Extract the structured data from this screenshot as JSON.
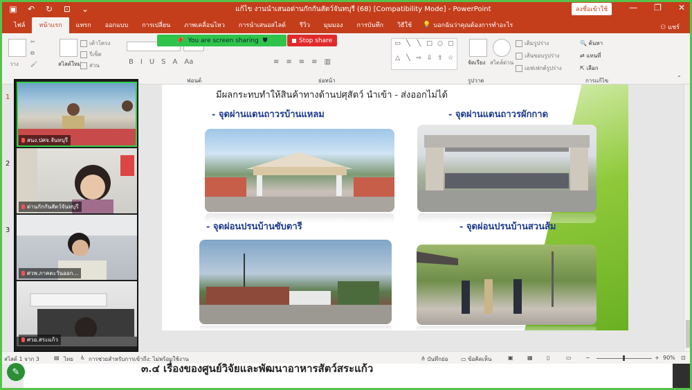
{
  "window": {
    "title": "แก้ไข งานนำเสนอด่านกักกันสัตว์จันทบุรี (68) [Compatibility Mode]  -  PowerPoint",
    "signin_label": "ลงชื่อเข้าใช้"
  },
  "tabs": [
    "ไฟล์",
    "หน้าแรก",
    "แทรก",
    "ออกแบบ",
    "การเปลี่ยน",
    "ภาพเคลื่อนไหว",
    "การนำเสนอสไลด์",
    "รีวิว",
    "มุมมอง",
    "การบันทึก",
    "วิธีใช้"
  ],
  "tell_me": "บอกฉันว่าคุณต้องการทำอะไร",
  "share_label": "แชร์",
  "screen_share": {
    "status": "You are screen sharing",
    "stop_label": "Stop share"
  },
  "ribbon": {
    "paste": "วาง",
    "new_slide": "สไลด์ใหม่",
    "layout": "เค้าโครง",
    "reset": "รีเซ็ต",
    "section": "ส่วน",
    "arrange": "จัดเรียง",
    "quick_styles": "สไตล์ด่วน",
    "shape_fill": "เติมรูปร่าง",
    "shape_outline": "เส้นขอบรูปร่าง",
    "shape_effects": "เอฟเฟกต์รูปร่าง",
    "find": "ค้นหา",
    "replace": "แทนที่",
    "select": "เลือก",
    "group_font": "ฟอนต์",
    "group_paragraph": "ย่อหน้า",
    "group_drawing": "รูปวาด",
    "group_editing": "การแก้ไข"
  },
  "thumbnails": [
    "1",
    "2",
    "3"
  ],
  "participants": [
    {
      "name": "สนง.ปศจ.จันทบุรี"
    },
    {
      "name": "ด่านกักกันสัตว์จันทบุรี"
    },
    {
      "name": "ศวพ.ภาคตะวันออก..."
    },
    {
      "name": "ศวอ.สระแก้ว"
    }
  ],
  "slide": {
    "intro_text": "มีผลกระทบทำให้สินค้าทางด้านปศุสัตว์ นำเข้า - ส่งออกไม่ได้",
    "captions": [
      "-   จุดผ่านแดนถาวรบ้านแหลม",
      "-   จุดผ่านแดนถาวรผักกาด",
      "-   จุดผ่อนปรนบ้านซับตารี",
      "-   จุดผ่อนปรนบ้านสวนส้ม"
    ]
  },
  "status": {
    "slide_counter": "สไลด์ 1 จาก 3",
    "language": "ไทย",
    "accessibility": "การช่วยสำหรับการเข้าถึง: ไม่พร้อมใช้งาน",
    "notes": "บันทึกย่อ",
    "comments": "ข้อคิดเห็น",
    "zoom": "90%"
  },
  "notes_text": "๓.๔ เรื่องของศูนย์วิจัยและพัฒนาอาหารสัตว์สระแก้ว"
}
